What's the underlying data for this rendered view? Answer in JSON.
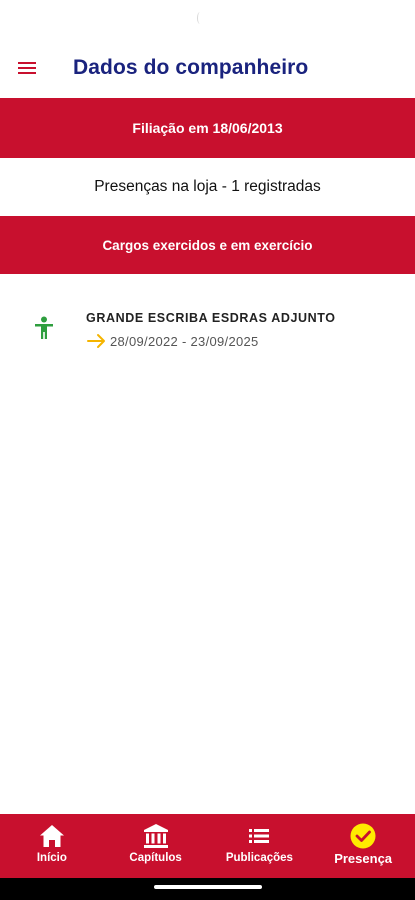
{
  "header": {
    "title": "Dados do companheiro",
    "menu_icon": "hamburger-menu-icon"
  },
  "filiacao": {
    "text": "Filiação em 18/06/2013"
  },
  "presencas": {
    "text": "Presenças na loja - 1 registradas"
  },
  "cargos_section": {
    "title": "Cargos exercidos e em exercício"
  },
  "cargos": [
    {
      "title": "GRANDE ESCRIBA ESDRAS ADJUNTO",
      "dates": "28/09/2022 - 23/09/2025",
      "icon": "person-icon",
      "arrow_icon": "arrow-right-icon"
    }
  ],
  "bottom_nav": {
    "items": [
      {
        "label": "Início",
        "icon": "home-icon"
      },
      {
        "label": "Capítulos",
        "icon": "bank-icon"
      },
      {
        "label": "Publicações",
        "icon": "list-icon"
      },
      {
        "label": "Presença",
        "icon": "check-circle-icon",
        "active": true
      }
    ]
  },
  "colors": {
    "primary": "#c8102e",
    "title": "#1a237e",
    "person_icon": "#2e9e3e",
    "arrow_icon": "#f5b400",
    "active_check": "#ffeb00"
  }
}
